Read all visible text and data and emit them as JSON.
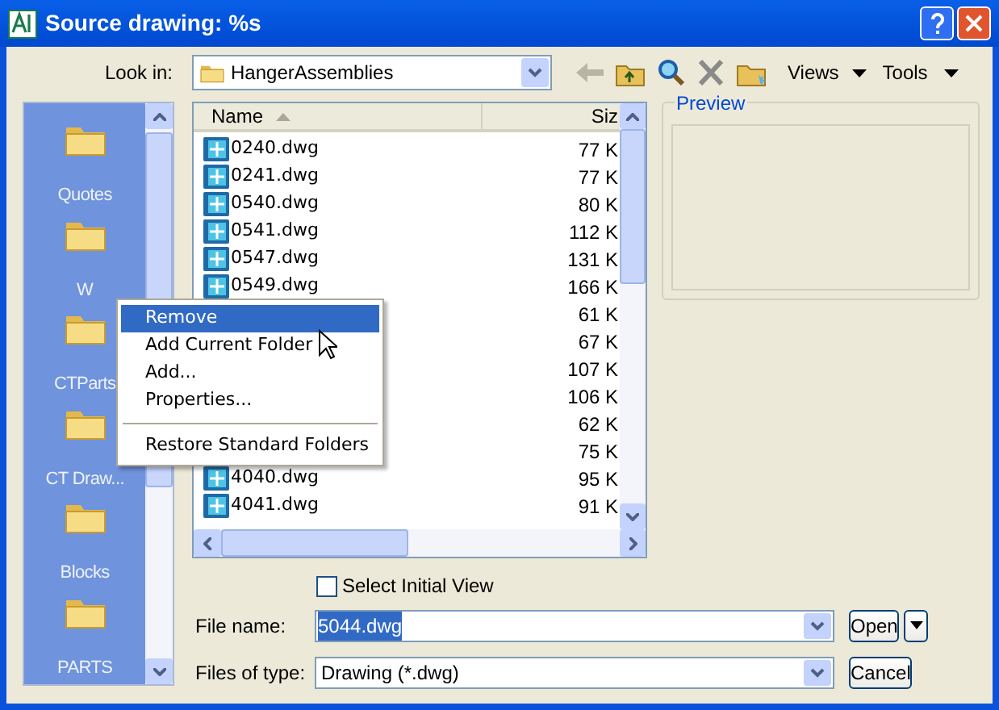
{
  "window": {
    "title": "Source drawing: %s"
  },
  "look_in": {
    "label": "Look in:",
    "value": "HangerAssemblies"
  },
  "toolbar": {
    "views": "Views",
    "tools": "Tools"
  },
  "places": [
    {
      "label": "Quotes"
    },
    {
      "label": "W"
    },
    {
      "label": "CTParts"
    },
    {
      "label": "CT Draw..."
    },
    {
      "label": "Blocks"
    },
    {
      "label": "PARTS"
    }
  ],
  "file_list": {
    "columns": [
      "Name",
      "Siz"
    ],
    "rows": [
      {
        "name": "0240.dwg",
        "size": "77 K"
      },
      {
        "name": "0241.dwg",
        "size": "77 K"
      },
      {
        "name": "0540.dwg",
        "size": "80 K"
      },
      {
        "name": "0541.dwg",
        "size": "112 K"
      },
      {
        "name": "0547.dwg",
        "size": "131 K"
      },
      {
        "name": "0549.dwg",
        "size": "166 K"
      },
      {
        "size": "61 K"
      },
      {
        "size": "67 K"
      },
      {
        "size": "107 K"
      },
      {
        "size": "106 K"
      },
      {
        "size": "62 K"
      },
      {
        "size": "75 K"
      },
      {
        "name": "4040.dwg",
        "size": "95 K"
      },
      {
        "name": "4041.dwg",
        "size": "91 K"
      }
    ]
  },
  "context_menu": {
    "items": [
      {
        "kind": "item",
        "label": "Remove",
        "selected": true
      },
      {
        "kind": "item",
        "label": "Add Current Folder",
        "selected": false
      },
      {
        "kind": "item",
        "label": "Add...",
        "selected": false
      },
      {
        "kind": "item",
        "label": "Properties...",
        "selected": false
      },
      {
        "kind": "separator"
      },
      {
        "kind": "item",
        "label": "Restore Standard Folders",
        "selected": false
      }
    ]
  },
  "preview": {
    "label": "Preview"
  },
  "select_initial_view": {
    "label": "Select Initial View",
    "checked": false
  },
  "file_name": {
    "label": "File name:",
    "value": "5044.dwg"
  },
  "files_of_type": {
    "label": "Files of type:",
    "value": "Drawing (*.dwg)"
  },
  "buttons": {
    "open": "Open",
    "cancel": "Cancel"
  }
}
